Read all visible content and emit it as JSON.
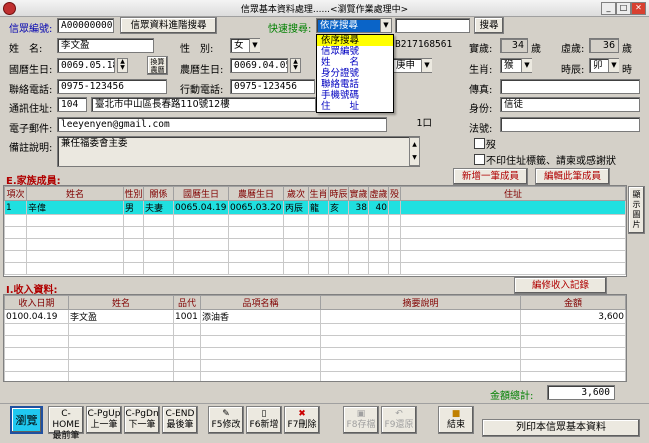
{
  "window": {
    "title": "信眾基本資料處理......<瀏覽作業處理中>"
  },
  "top": {
    "member_no_label": "信眾編號:",
    "member_no": "A000000005",
    "query_button": "信眾資料進階搜尋",
    "quick_search_label": "快速搜尋:",
    "quick_search_value": "依序搜尋",
    "search_input": "",
    "search_button": "搜尋"
  },
  "dropdown": {
    "items": [
      "依序搜尋",
      "信眾編號",
      "姓　　名",
      "身分證號",
      "聯絡電話",
      "手機號碼",
      "住　　址"
    ],
    "selected": 0
  },
  "form": {
    "name_label": "姓　名:",
    "name": "李文盈",
    "sex_label": "性　別:",
    "sex": "女",
    "id_no": "B217168561",
    "virtual_age_label": "實歲:",
    "virtual_age": "34",
    "virtual_age_unit": "歲",
    "nominal_age_label": "虛歲:",
    "nominal_age": "36",
    "nominal_age_unit": "歲",
    "birth_label": "國曆生日:",
    "birth": "0069.05.18",
    "birth_btn": "換算農曆",
    "lunar_label": "農曆生日:",
    "lunar": "0069.04.05",
    "ganzhi": "庚申",
    "zodiac_label": "生肖:",
    "zodiac": "猴",
    "hour_label": "時辰:",
    "hour": "卯",
    "hour_unit": "時",
    "phone_label": "聯絡電話:",
    "phone": "0975-123456",
    "mobile_label": "行動電話:",
    "mobile": "0975-123456",
    "fax_label": "傳真:",
    "fax": "",
    "addr_label": "通訊住址:",
    "zip": "104",
    "addr": "臺北市中山區長春路110號12樓",
    "identity_label": "身份:",
    "identity": "信徒",
    "email_label": "電子郵件:",
    "email": "leeyenyen@gmail.com",
    "mouth_suffix": "1口",
    "dharma_label": "法號:",
    "dharma": "",
    "note_label": "備註說明:",
    "note": "兼任福委會主委",
    "check1": "歿",
    "check2": "不印住址標籤、請柬或感謝狀"
  },
  "family": {
    "title": "E.家族成員:",
    "add_button": "新增一筆成員",
    "edit_button": "編輯此筆成員",
    "side_button": "顯示圖片",
    "columns": [
      "項次",
      "姓名",
      "性別",
      "關係",
      "國曆生日",
      "農曆生日",
      "歲次",
      "生肖",
      "時辰",
      "實歲",
      "虛歲",
      "殁",
      "住址"
    ],
    "rows": [
      [
        "1",
        "辛偉",
        "男",
        "夫妻",
        "0065.04.19",
        "0065.03.20",
        "丙辰",
        "龍",
        "亥",
        "38",
        "40",
        "",
        ""
      ]
    ]
  },
  "income": {
    "title": "I.收入資料:",
    "edit_button": "編修收入記錄",
    "columns": [
      "收入日期",
      "姓名",
      "品代",
      "品項名稱",
      "摘要說明",
      "金額"
    ],
    "rows": [
      [
        "0100.04.19",
        "李文盈",
        "1001",
        "添油香",
        "",
        "3,600"
      ]
    ],
    "total_label": "金額總計:",
    "total": "3,600"
  },
  "toolbar": {
    "browse": "瀏覽",
    "first_key": "C-HOME",
    "first": "最前筆",
    "prev_key": "C-PgUp",
    "prev": "上一筆",
    "next_key": "C-PgDn",
    "next": "下一筆",
    "last_key": "C-END",
    "last": "最後筆",
    "edit": "F5修改",
    "add": "F6新增",
    "del": "F7刪除",
    "save": "F8存檔",
    "undo": "F9還原",
    "exit": "結束",
    "print": "列印本信眾基本資料"
  }
}
